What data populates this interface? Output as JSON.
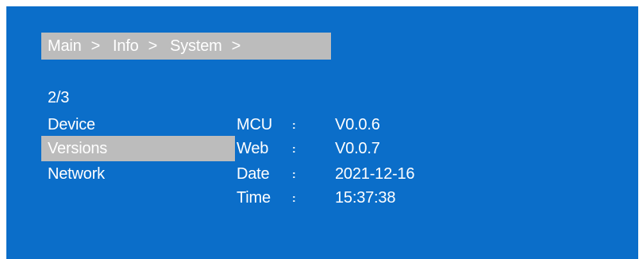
{
  "breadcrumb": {
    "items": [
      "Main",
      "Info",
      "System"
    ],
    "separator": ">"
  },
  "page_indicator": "2/3",
  "menu": {
    "items": [
      {
        "label": "Device",
        "selected": false
      },
      {
        "label": "Versions",
        "selected": true
      },
      {
        "label": "Network",
        "selected": false
      }
    ]
  },
  "info": {
    "separator": ":",
    "rows": [
      {
        "label": "MCU",
        "value": "V0.0.6"
      },
      {
        "label": "Web",
        "value": "V0.0.7"
      },
      {
        "label": "Date",
        "value": "2021-12-16"
      },
      {
        "label": "Time",
        "value": "15:37:38"
      }
    ]
  },
  "colors": {
    "background": "#0b6ec9",
    "highlight": "#bcbcbc",
    "text": "#ffffff"
  }
}
